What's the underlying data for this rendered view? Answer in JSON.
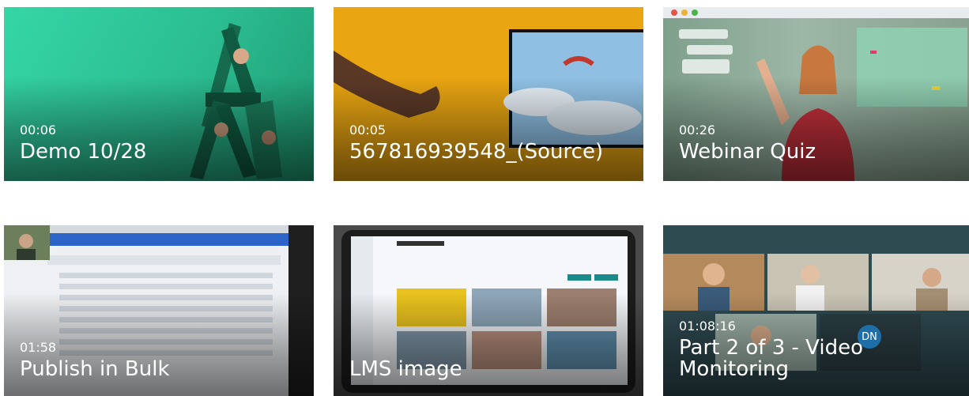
{
  "cards": [
    {
      "duration": "00:06",
      "title": "Demo 10/28",
      "colors": {
        "bg": "#2fc79a",
        "dark": "#1d8c64"
      }
    },
    {
      "duration": "00:05",
      "title": "567816939548_(Source)",
      "colors": {
        "bg": "#e7a412",
        "sky": "#9fc8e6"
      }
    },
    {
      "duration": "00:26",
      "title": "Webinar Quiz",
      "colors": {
        "bg": "#6f8b7c",
        "shirt": "#c0303b"
      }
    },
    {
      "duration": "01:58",
      "title": "Publish in Bulk",
      "colors": {
        "bg": "#2a2a2a",
        "screen": "#f3f4f6"
      }
    },
    {
      "duration": "",
      "title": "LMS image",
      "colors": {
        "bg": "#555555",
        "panel": "#f5f7fa",
        "accent": "#1b8a8a"
      }
    },
    {
      "duration": "01:08:16",
      "title": "Part 2 of 3 - Video Monitoring",
      "badge": "DN",
      "colors": {
        "bg": "#2e4a50",
        "badge": "#1e6fa8"
      }
    }
  ]
}
